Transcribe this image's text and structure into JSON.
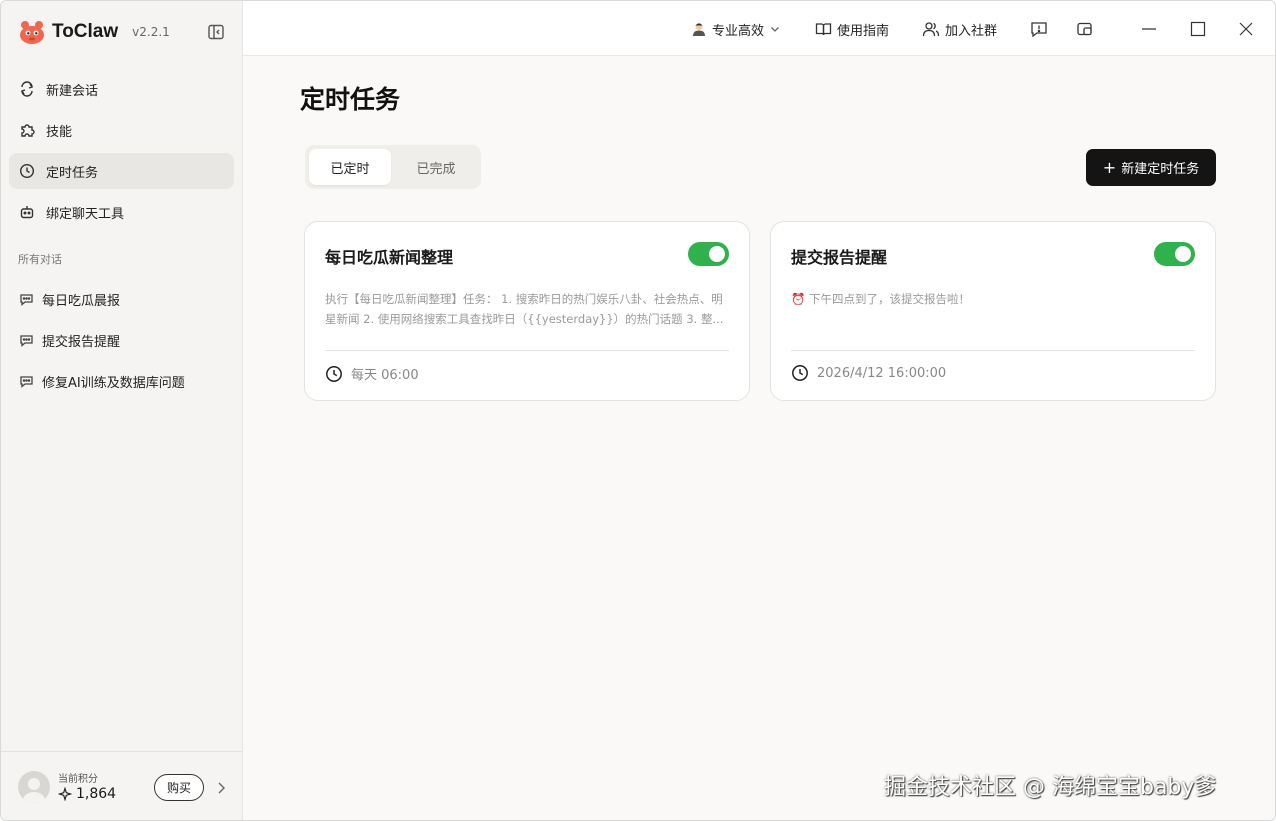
{
  "app": {
    "name": "ToClaw",
    "version": "v2.2.1"
  },
  "sidebar": {
    "nav": [
      {
        "label": "新建会话",
        "icon": "new-chat-icon"
      },
      {
        "label": "技能",
        "icon": "puzzle-icon"
      },
      {
        "label": "定时任务",
        "icon": "clock-icon",
        "active": true
      },
      {
        "label": "绑定聊天工具",
        "icon": "bot-icon"
      }
    ],
    "section_label": "所有对话",
    "conversations": [
      {
        "label": "每日吃瓜晨报"
      },
      {
        "label": "提交报告提醒"
      },
      {
        "label": "修复AI训练及数据库问题"
      }
    ],
    "footer": {
      "points_label": "当前积分",
      "points_value": "1,864",
      "buy_label": "购买"
    }
  },
  "topbar": {
    "mode": "专业高效",
    "guide": "使用指南",
    "community": "加入社群"
  },
  "main": {
    "title": "定时任务",
    "tabs": [
      {
        "label": "已定时",
        "active": true
      },
      {
        "label": "已完成",
        "active": false
      }
    ],
    "new_button": "新建定时任务",
    "cards": [
      {
        "title": "每日吃瓜新闻整理",
        "enabled": true,
        "desc": "执行【每日吃瓜新闻整理】任务： 1. 搜索昨日的热门娱乐八卦、社会热点、明星新闻 2. 使用网络搜索工具查找昨日（{{yesterday}}）的热门话题 3. 整...",
        "schedule": "每天 06:00"
      },
      {
        "title": "提交报告提醒",
        "enabled": true,
        "desc": "⏰ 下午四点到了，该提交报告啦！",
        "schedule": "2026/4/12 16:00:00"
      }
    ]
  },
  "watermark": "掘金技术社区 @ 海绵宝宝baby爹",
  "colors": {
    "accent_green": "#2fb24c",
    "primary_button": "#141414",
    "sidebar_bg": "#f5f4f2",
    "main_bg": "#faf9f7"
  }
}
